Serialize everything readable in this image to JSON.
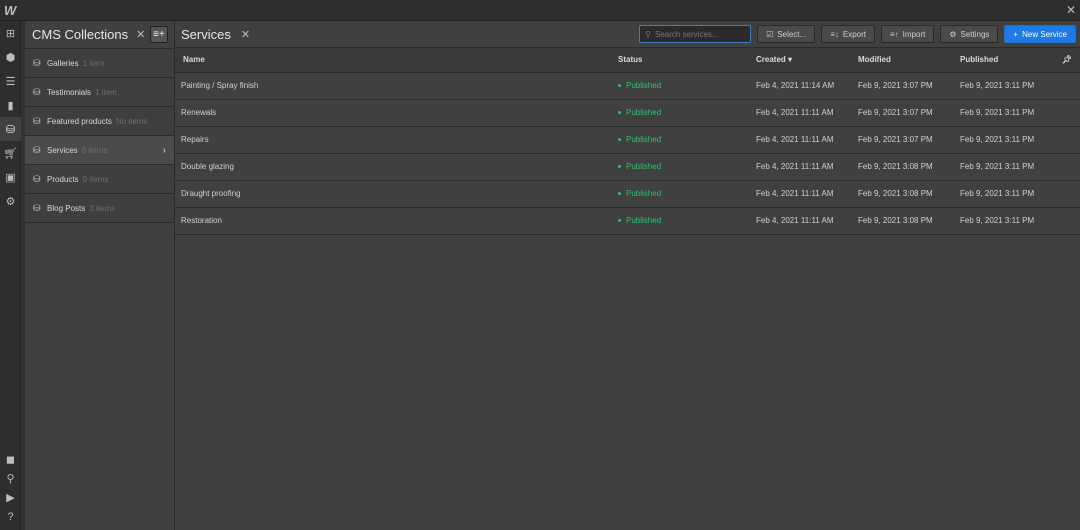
{
  "app": {
    "logo": "W"
  },
  "rail": {
    "icons": [
      "add-icon",
      "cube-icon",
      "navigator-icon",
      "pages-icon",
      "cms-icon",
      "ecommerce-icon",
      "assets-icon",
      "settings-icon"
    ],
    "bottom_icons": [
      "square-icon",
      "search-icon",
      "video-icon",
      "help-icon"
    ]
  },
  "sidebar": {
    "title": "CMS Collections",
    "items": [
      {
        "label": "Galleries",
        "count": "1 item"
      },
      {
        "label": "Testimonials",
        "count": "1 item"
      },
      {
        "label": "Featured products",
        "count": "No items"
      },
      {
        "label": "Services",
        "count": "6 items",
        "selected": true
      },
      {
        "label": "Products",
        "count": "9 items"
      },
      {
        "label": "Blog Posts",
        "count": "3 items"
      }
    ]
  },
  "main": {
    "title": "Services",
    "search_placeholder": "Search services...",
    "select_label": "Select...",
    "export_label": "Export",
    "import_label": "Import",
    "settings_label": "Settings",
    "new_label": "New Service",
    "accent": "#1d7ae6",
    "columns": [
      "Name",
      "Status",
      "Created",
      "Modified",
      "Published"
    ],
    "rows": [
      [
        "Painting / Spray finish",
        "Published",
        "Feb 4, 2021 11:14 AM",
        "Feb 9, 2021 3:07 PM",
        "Feb 9, 2021 3:11 PM"
      ],
      [
        "Renewals",
        "Published",
        "Feb 4, 2021 11:11 AM",
        "Feb 9, 2021 3:07 PM",
        "Feb 9, 2021 3:11 PM"
      ],
      [
        "Repairs",
        "Published",
        "Feb 4, 2021 11:11 AM",
        "Feb 9, 2021 3:07 PM",
        "Feb 9, 2021 3:11 PM"
      ],
      [
        "Double glazing",
        "Published",
        "Feb 4, 2021 11:11 AM",
        "Feb 9, 2021 3:08 PM",
        "Feb 9, 2021 3:11 PM"
      ],
      [
        "Draught proofing",
        "Published",
        "Feb 4, 2021 11:11 AM",
        "Feb 9, 2021 3:08 PM",
        "Feb 9, 2021 3:11 PM"
      ],
      [
        "Restoration",
        "Published",
        "Feb 4, 2021 11:11 AM",
        "Feb 9, 2021 3:08 PM",
        "Feb 9, 2021 3:11 PM"
      ]
    ]
  }
}
